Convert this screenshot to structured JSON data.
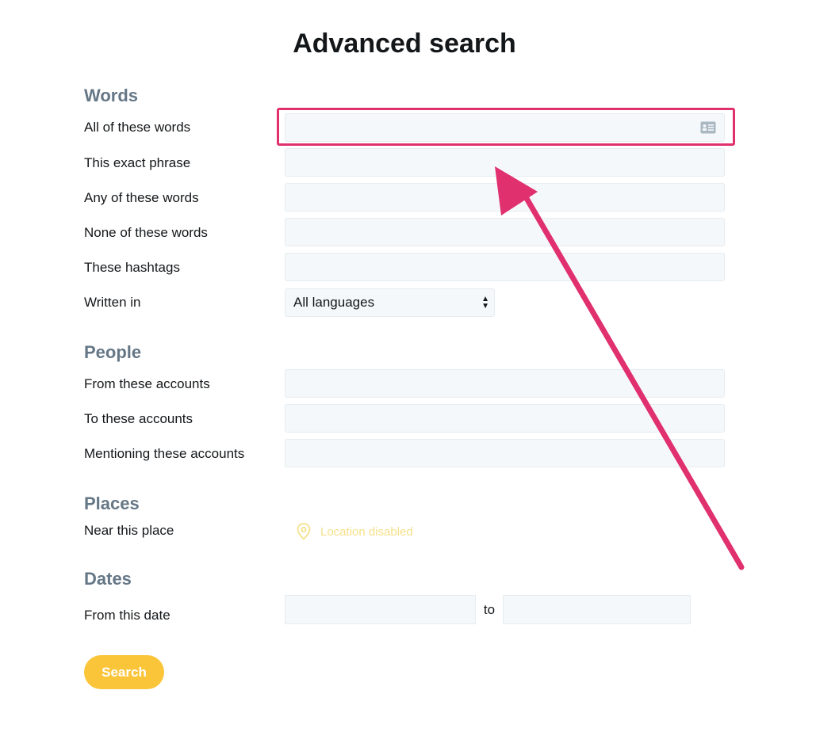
{
  "page": {
    "title": "Advanced search"
  },
  "sections": {
    "words": "Words",
    "people": "People",
    "places": "Places",
    "dates": "Dates"
  },
  "words": {
    "all": {
      "label": "All of these words",
      "value": ""
    },
    "exact": {
      "label": "This exact phrase",
      "value": ""
    },
    "any": {
      "label": "Any of these words",
      "value": ""
    },
    "none": {
      "label": "None of these words",
      "value": ""
    },
    "hashtags": {
      "label": "These hashtags",
      "value": ""
    },
    "language": {
      "label": "Written in",
      "selected": "All languages"
    }
  },
  "people": {
    "from": {
      "label": "From these accounts",
      "value": ""
    },
    "to": {
      "label": "To these accounts",
      "value": ""
    },
    "mentioning": {
      "label": "Mentioning these accounts",
      "value": ""
    }
  },
  "places": {
    "near": {
      "label": "Near this place",
      "status": "Location disabled"
    }
  },
  "dates": {
    "from": {
      "label": "From this date",
      "separator": "to"
    }
  },
  "actions": {
    "search_label": "Search"
  },
  "colors": {
    "accent": "#fbc53a",
    "highlight": "#e0306e",
    "section": "#657786",
    "location_disabled": "#f5e08a"
  },
  "icons": {
    "field_icon": "contact-card-icon",
    "location_icon": "location-pin-icon",
    "select_icon": "updown-arrows-icon"
  }
}
